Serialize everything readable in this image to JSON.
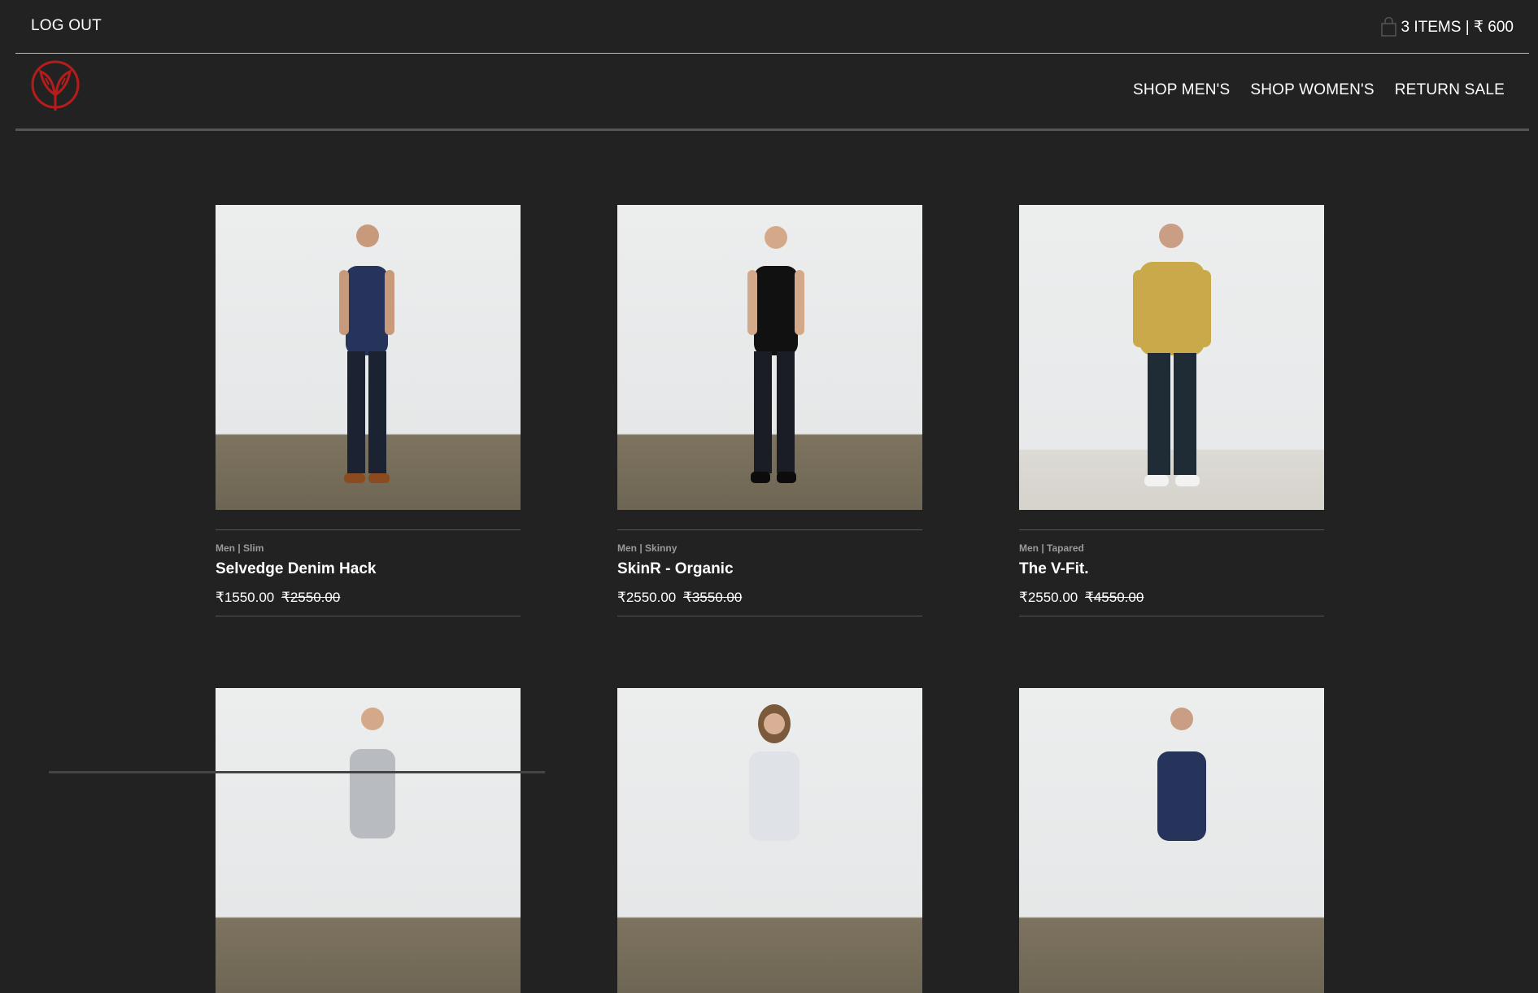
{
  "header": {
    "logout_label": "LOG OUT",
    "cart_label": "3 ITEMS | ₹ 600",
    "cart_icon": "shopping-bag-icon"
  },
  "logo": {
    "icon": "v-leaf-logo",
    "color": "#b71c1c"
  },
  "nav": {
    "links": [
      "SHOP MEN'S",
      "SHOP WOMEN'S",
      "RETURN SALE"
    ]
  },
  "products": [
    {
      "category": "Men | Slim",
      "title": "Selvedge Denim Hack",
      "price": "₹1550.00",
      "original_price": "₹2550.00",
      "shirt_color": "#26335a"
    },
    {
      "category": "Men | Skinny",
      "title": "SkinR - Organic",
      "price": "₹2550.00",
      "original_price": "₹3550.00",
      "shirt_color": "#111111"
    },
    {
      "category": "Men | Tapared",
      "title": "The V-Fit.",
      "price": "₹2550.00",
      "original_price": "₹4550.00",
      "shirt_color": "#c9a94a"
    },
    {
      "shirt_color": "#b8bcc0"
    },
    {
      "shirt_color": "#dfe3e8"
    },
    {
      "shirt_color": "#26335a"
    }
  ]
}
